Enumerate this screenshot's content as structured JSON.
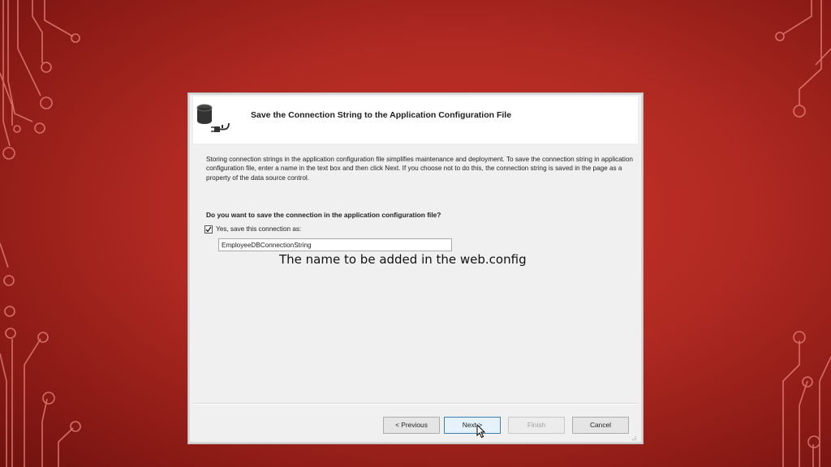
{
  "dialog": {
    "title": "Save the Connection String to the Application Configuration File",
    "icon": "database-plug-icon",
    "description": "Storing connection strings in the application configuration file simplifies maintenance and deployment. To save the connection string in application configuration file, enter a name in the text box and then click Next. If you choose not to do this, the connection string is saved in the page as a property of the data source control.",
    "question": "Do you want to save the connection in the application configuration file?",
    "checkbox": {
      "label": "Yes, save this connection as:",
      "checked": true
    },
    "connection_name": {
      "value": "EmployeeDBConnectionString"
    },
    "buttons": {
      "previous": "< Previous",
      "next": "Next >",
      "finish": "Finish",
      "cancel": "Cancel"
    }
  },
  "annotation": "The name to be added in the web.config",
  "colors": {
    "background": "#b02a22",
    "circuit": "#e07a70",
    "dialog_bg": "#f0f0f0",
    "header_bg": "#ffffff"
  }
}
